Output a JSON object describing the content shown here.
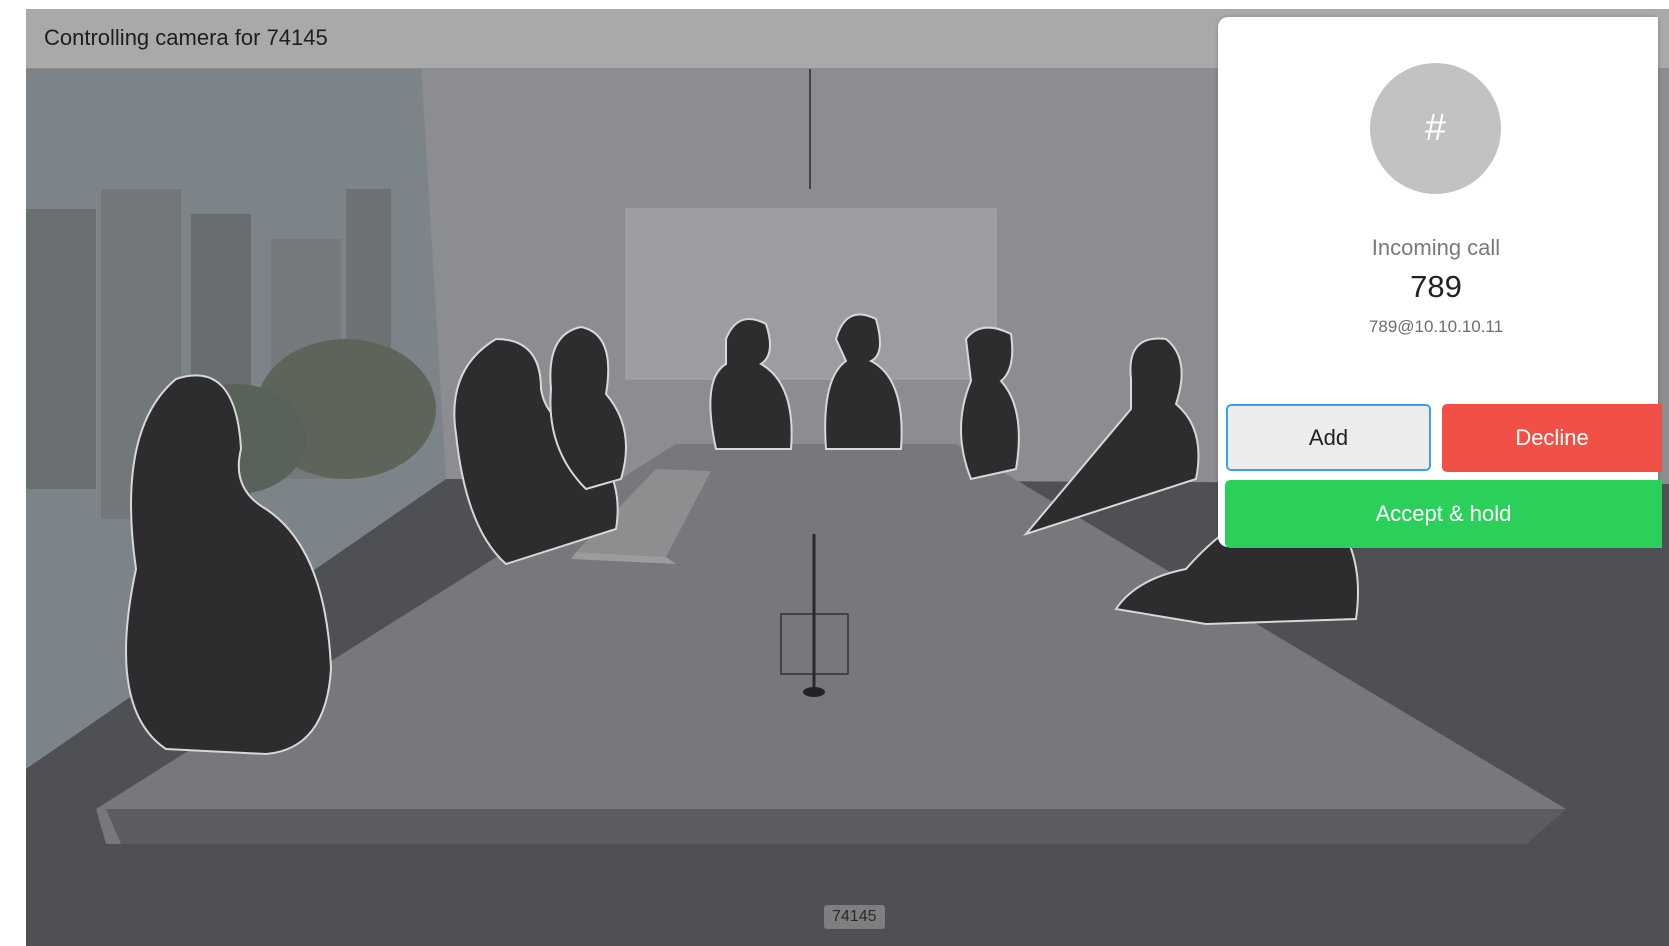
{
  "header": {
    "title": "Controlling camera for 74145"
  },
  "incoming_call": {
    "avatar_symbol": "#",
    "status": "Incoming call",
    "caller_name": "789",
    "caller_uri": "789@10.10.10.11",
    "add_label": "Add",
    "decline_label": "Decline",
    "accept_hold_label": "Accept & hold"
  },
  "video": {
    "self_view_label": "74145"
  },
  "colors": {
    "decline": "#f15046",
    "accept": "#2bd05a",
    "focus_outline": "#3aa0ef"
  }
}
